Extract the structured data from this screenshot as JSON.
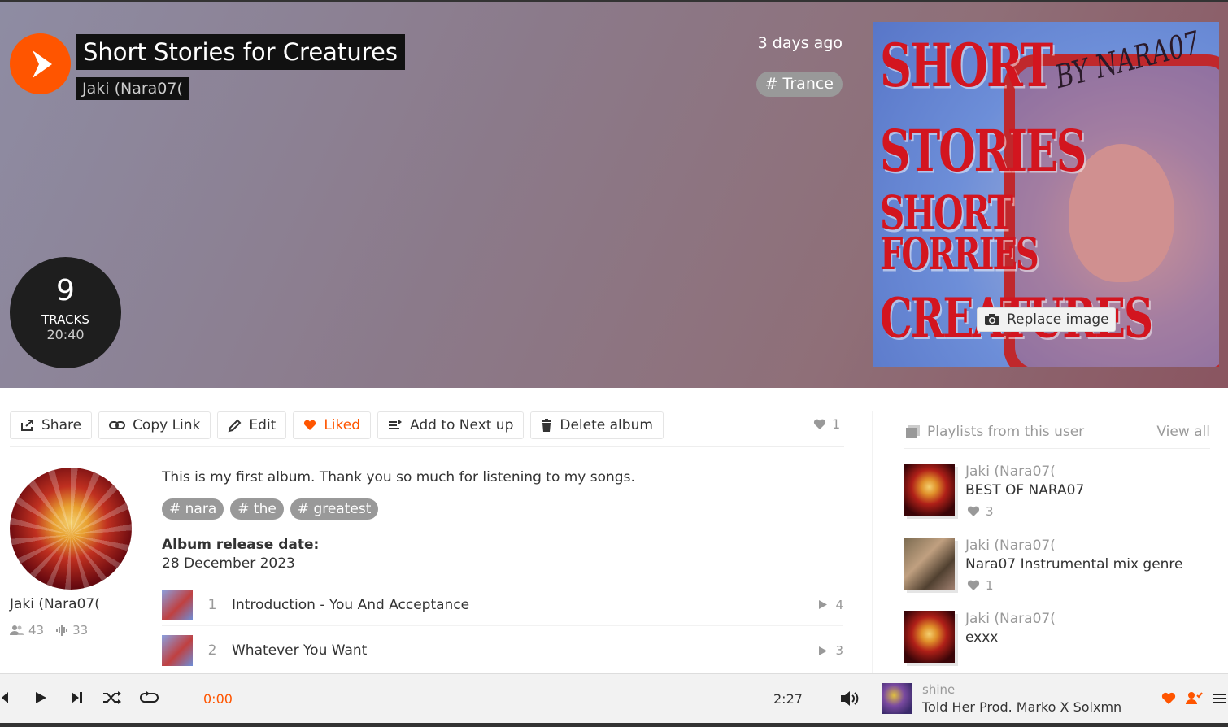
{
  "hero": {
    "title": "Short Stories for Creatures",
    "artist": "Jaki (Nara07(",
    "date": "3 days ago",
    "genre_tag": "# Trance",
    "track_count": "9",
    "tracks_label": "TRACKS",
    "duration": "20:40",
    "replace_image_label": "Replace image",
    "cover_words": [
      "SHORT",
      "STORIES",
      "SHORT",
      "FORRIES",
      "CREATURES"
    ],
    "cover_byline": "BY NARA07"
  },
  "actions": {
    "share": "Share",
    "copy_link": "Copy Link",
    "edit": "Edit",
    "liked": "Liked",
    "add_next": "Add to Next up",
    "delete": "Delete album",
    "like_count": "1"
  },
  "artist": {
    "name": "Jaki (Nara07(",
    "followers": "43",
    "tracks": "33"
  },
  "album": {
    "description": "This is my first album. Thank you so much for listening to my songs.",
    "tags": [
      "# nara",
      "# the",
      "# greatest"
    ],
    "release_label": "Album release date:",
    "release_date": "28 December 2023"
  },
  "tracks": [
    {
      "num": "1",
      "title": "Introduction - You And Acceptance",
      "plays": "4"
    },
    {
      "num": "2",
      "title": "Whatever You Want",
      "plays": "3"
    }
  ],
  "sidebar": {
    "heading": "Playlists from this user",
    "view_all": "View all",
    "playlists": [
      {
        "owner": "Jaki (Nara07(",
        "title": "BEST OF NARA07",
        "likes": "3"
      },
      {
        "owner": "Jaki (Nara07(",
        "title": "Nara07 Instrumental mix genre",
        "likes": "1"
      },
      {
        "owner": "Jaki (Nara07(",
        "title": "exxx",
        "likes": ""
      }
    ]
  },
  "player": {
    "current_time": "0:00",
    "total_time": "2:27",
    "now_playing_artist": "shine",
    "now_playing_title": "Told Her Prod. Marko X Solxmn"
  },
  "colors": {
    "accent": "#ff5500",
    "tag_bg": "#999999",
    "dark": "#111111"
  }
}
